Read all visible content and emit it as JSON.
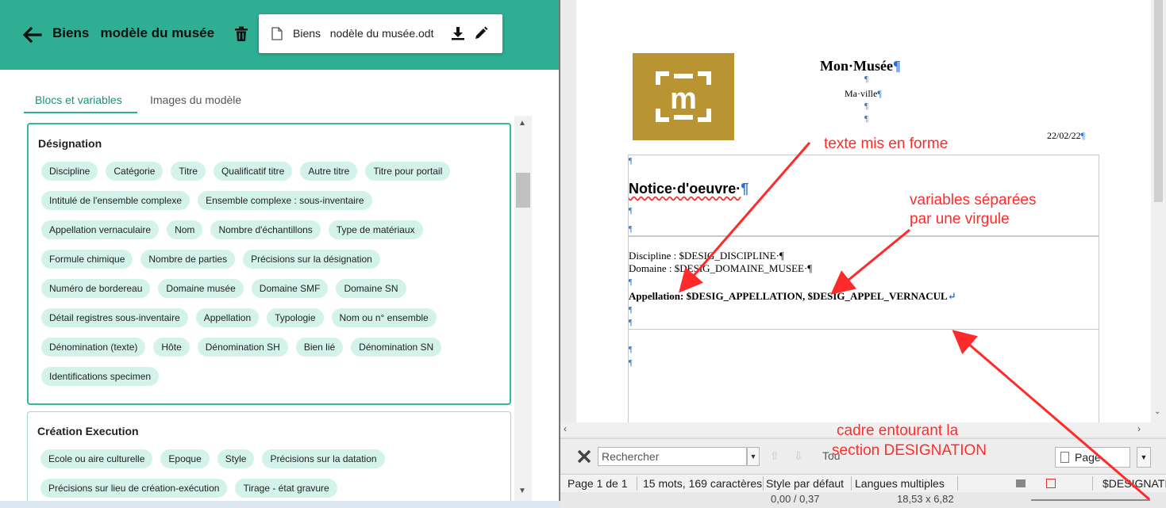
{
  "header": {
    "model_title": "Biens   modèle du musée",
    "file_name": "Biens   nodèle du musée.odt"
  },
  "tabs": [
    {
      "label": "Blocs et variables"
    },
    {
      "label": "Images du modèle"
    }
  ],
  "cards": [
    {
      "title": "Désignation",
      "rows": [
        [
          "Discipline",
          "Catégorie",
          "Titre",
          "Qualificatif titre",
          "Autre titre",
          "Titre pour portail"
        ],
        [
          "Intitulé de l'ensemble complexe",
          "Ensemble complexe : sous-inventaire"
        ],
        [
          "Appellation vernaculaire",
          "Nom",
          "Nombre d'échantillons",
          "Type de matériaux"
        ],
        [
          "Formule chimique",
          "Nombre de parties",
          "Précisions sur la désignation"
        ],
        [
          "Numéro de bordereau",
          "Domaine musée",
          "Domaine SMF",
          "Domaine SN"
        ],
        [
          "Détail registres sous-inventaire",
          "Appellation",
          "Typologie",
          "Nom ou n° ensemble"
        ],
        [
          "Dénomination (texte)",
          "Hôte",
          "Dénomination SH",
          "Bien lié",
          "Dénomination SN"
        ],
        [
          "Identifications specimen"
        ]
      ]
    },
    {
      "title": "Création Execution",
      "rows": [
        [
          "Ecole ou aire culturelle",
          "Epoque",
          "Style",
          "Précisions sur la datation"
        ],
        [
          "Précisions sur lieu de création-exécution",
          "Tirage - état gravure"
        ]
      ]
    }
  ],
  "document": {
    "logo_letter": "m",
    "museum_name": "Mon·Musée",
    "town": "Ma·ville",
    "date": "22/02/22",
    "pilcrow": "¶",
    "notice_title": "Notice·d'oeuvre·",
    "line_discipline": "Discipline : $DESIG_DISCIPLINE·¶",
    "line_domaine": "Domaine : $DESIG_DOMAINE_MUSEE·¶",
    "line_appellation": "Appellation: $DESIG_APPELLATION, $DESIG_APPEL_VERNACUL",
    "line_break_mark": "↵"
  },
  "annotations": {
    "texte": "texte mis en forme",
    "variables_1": "variables séparées",
    "variables_2": "par une virgule",
    "cadre_1": "cadre entourant la",
    "cadre_2": "section DESIGNATION"
  },
  "findbar": {
    "search_placeholder": "Rechercher",
    "find_all_partial": "Tou",
    "page_select": "Page"
  },
  "statusbar": {
    "page": "Page 1 de 1",
    "words": "15 mots, 169 caractères",
    "style": "Style par défaut",
    "language": "Langues multiples",
    "section": "$DESIGNATIC",
    "position": "0,00 / 0,37",
    "size": "18,53 x 6,82"
  },
  "colors": {
    "brand": "#2eae92",
    "chip": "#d3f3ea",
    "logo": "#b89433",
    "annotation": "#ff2a2a"
  }
}
